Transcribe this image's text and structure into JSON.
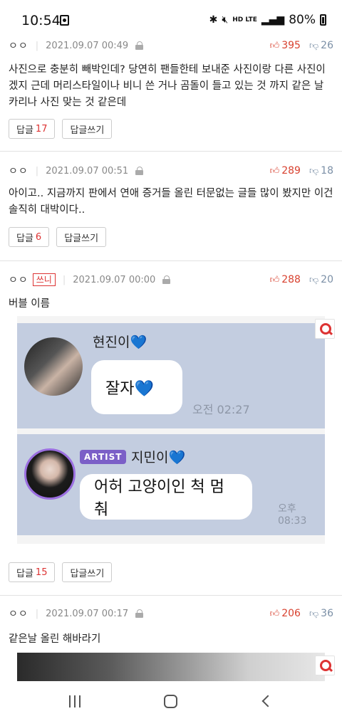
{
  "status_bar": {
    "time": "10:54",
    "network": "HD LTE",
    "battery": "80%"
  },
  "comments": [
    {
      "nickname": "ㅇㅇ",
      "tag": "",
      "date": "2021.09.07 00:49",
      "upvotes": "395",
      "downvotes": "26",
      "text": "사진으로 충분히 빼박인데? 당연히 팬들한테 보내준 사진이랑 다른 사진이겠지 근데 머리스타일이나 비니 쓴 거나 곰돌이 들고 있는 것 까지 같은 날 카리나 사진 맞는 것 같은데",
      "reply_label": "답글",
      "reply_count": "17",
      "write_reply_label": "답글쓰기"
    },
    {
      "nickname": "ㅇㅇ",
      "tag": "",
      "date": "2021.09.07 00:51",
      "upvotes": "289",
      "downvotes": "18",
      "text": "아이고.. 지금까지 판에서 연애 증거들 올린 터문없는 글들 많이 봤지만 이건 솔직히 대박이다..",
      "reply_label": "답글",
      "reply_count": "6",
      "write_reply_label": "답글쓰기"
    },
    {
      "nickname": "ㅇㅇ",
      "tag": "쓰니",
      "date": "2021.09.07 00:00",
      "upvotes": "288",
      "downvotes": "20",
      "text": "버블 이름",
      "reply_label": "답글",
      "reply_count": "15",
      "write_reply_label": "답글쓰기",
      "chat_image": {
        "msg1": {
          "name": "현진이",
          "heart": "💙",
          "bubble": "잘자💙",
          "time": "오전 02:27"
        },
        "msg2": {
          "badge": "ARTIST",
          "name": "지민이",
          "heart": "💙",
          "bubble": "어허 고양이인 척 멈춰",
          "time": "오후 08:33"
        }
      }
    },
    {
      "nickname": "ㅇㅇ",
      "tag": "",
      "date": "2021.09.07 00:17",
      "upvotes": "206",
      "downvotes": "36",
      "text": "같은날 올린 해바라기"
    }
  ]
}
